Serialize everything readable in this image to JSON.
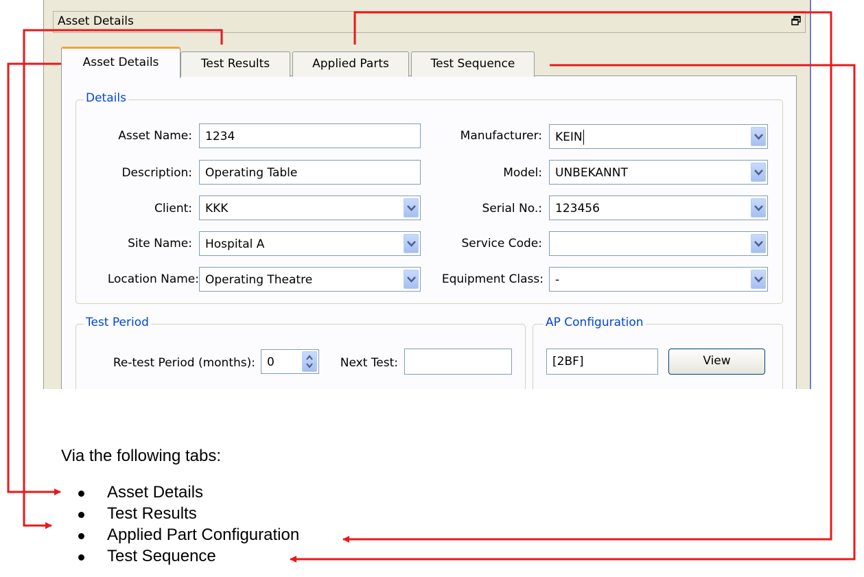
{
  "window": {
    "title": "Asset Details",
    "restore_icon": "restore-window-icon"
  },
  "tabs": [
    {
      "label": "Asset Details",
      "active": true
    },
    {
      "label": "Test Results",
      "active": false
    },
    {
      "label": "Applied Parts",
      "active": false
    },
    {
      "label": "Test Sequence",
      "active": false
    }
  ],
  "details": {
    "legend": "Details",
    "asset_name": {
      "label": "Asset Name:",
      "value": "1234"
    },
    "description": {
      "label": "Description:",
      "value": "Operating Table"
    },
    "client": {
      "label": "Client:",
      "value": "KKK"
    },
    "site_name": {
      "label": "Site Name:",
      "value": "Hospital A"
    },
    "location_name": {
      "label": "Location Name:",
      "value": "Operating Theatre"
    },
    "manufacturer": {
      "label": "Manufacturer:",
      "value": "KEIN"
    },
    "model": {
      "label": "Model:",
      "value": "UNBEKANNT"
    },
    "serial_no": {
      "label": "Serial No.:",
      "value": "123456"
    },
    "service_code": {
      "label": "Service Code:",
      "value": ""
    },
    "equipment_class": {
      "label": "Equipment Class:",
      "value": "-"
    }
  },
  "test_period": {
    "legend": "Test Period",
    "retest_label": "Re-test Period (months):",
    "retest_value": "0",
    "next_test_label": "Next Test:",
    "next_test_value": ""
  },
  "ap_configuration": {
    "legend": "AP Configuration",
    "value": "[2BF]",
    "view_button": "View"
  },
  "document": {
    "intro": "Via the following tabs:",
    "bullets": [
      "Asset Details",
      "Test Results",
      "Applied Part Configuration",
      "Test Sequence"
    ]
  },
  "colors": {
    "annotation_arrow": "#e8191a",
    "legend_text": "#0046d5",
    "active_tab_highlight": "#f2a33a"
  }
}
